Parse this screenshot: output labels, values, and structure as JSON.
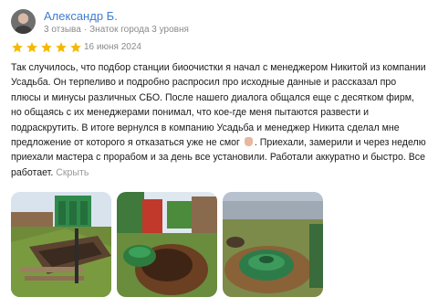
{
  "reviewer": {
    "name": "Александр Б.",
    "reviews_count": "3 отзыва",
    "badge": "Знаток города 3 уровня"
  },
  "rating": {
    "stars": 5,
    "max": 5,
    "star_color": "#f5b800",
    "date": "16 июня 2024"
  },
  "review": {
    "text_before_emoji": "Так случилось, что подбор станции биоочистки я начал с менеджером Никитой из компании Усадьба. Он терпеливо и подробно распросил про исходные данные и рассказал про плюсы и минусы различных СБО. После нашего диалога общался еще с десятком фирм, но общаясь с их менеджерами понимал, что кое-где меня пытаются развести и подраскрутить. В итоге вернулся в компанию Усадьба и менеджер Никита сделал мне предложение от которого я отказаться уже не смог",
    "emoji": "hand-icon",
    "text_after_emoji": ". Приехали, замерили и через неделю приехали мастера с прорабом и за день все установили. Работали аккуратно и быстро. Все работает.",
    "collapse_label": "Скрыть"
  },
  "colors": {
    "name_link": "#3f7ccf",
    "meta_text": "#8a8a8a",
    "collapse_text": "#9a9a9a"
  }
}
